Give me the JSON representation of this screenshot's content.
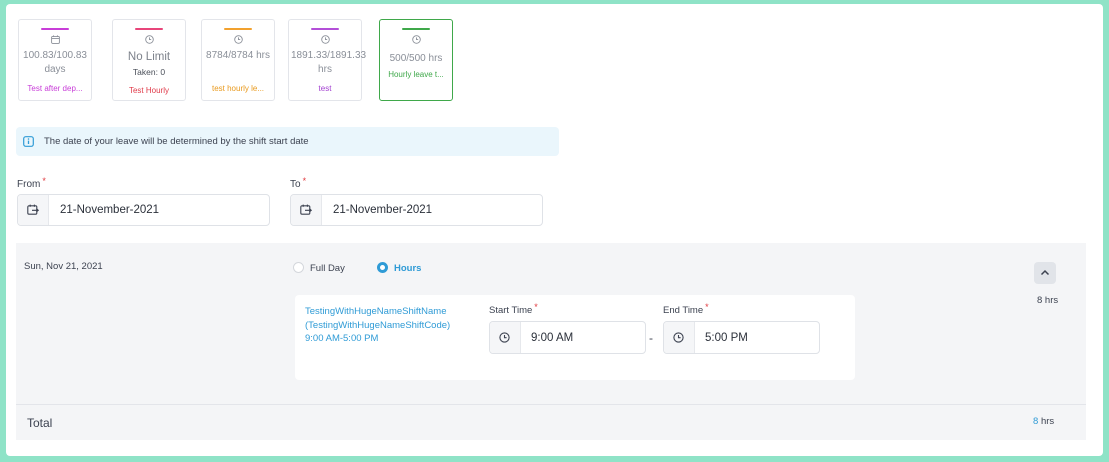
{
  "leave_cards": [
    {
      "value": "100.83/100.83 days",
      "taken": "",
      "name": "Test after dep...",
      "bar_color": "#c83dd8",
      "name_color": "#c83dd8",
      "icon": "calendar-icon",
      "active": false
    },
    {
      "value": "No Limit",
      "taken": "Taken: 0",
      "name": "Test Hourly",
      "bar_color": "#e8457a",
      "name_color": "#e03b4a",
      "icon": "clock-icon",
      "active": false
    },
    {
      "value": "8784/8784 hrs",
      "taken": "",
      "name": "test hourly le...",
      "bar_color": "#f2a12e",
      "name_color": "#e99a1e",
      "icon": "clock-icon",
      "active": false
    },
    {
      "value": "1891.33/1891.33 hrs",
      "taken": "",
      "name": "test",
      "bar_color": "#b34fd8",
      "name_color": "#a23fd0",
      "icon": "clock-icon",
      "active": false
    },
    {
      "value": "500/500 hrs",
      "taken": "",
      "name": "Hourly leave t...",
      "bar_color": "#3fa84a",
      "name_color": "#3fa84a",
      "icon": "clock-icon",
      "active": true
    }
  ],
  "info": {
    "text": "The date of your leave will be determined by the shift start date",
    "icon": "info-icon"
  },
  "from": {
    "label": "From",
    "required": "*",
    "value": "21-November-2021",
    "icon": "calendar-swap-icon"
  },
  "to": {
    "label": "To",
    "required": "*",
    "value": "21-November-2021",
    "icon": "calendar-swap-icon"
  },
  "day": {
    "date": "Sun, Nov 21, 2021",
    "full_day_label": "Full Day",
    "hours_label": "Hours",
    "selected": "hours",
    "hours_total": "8 hrs",
    "shift": {
      "name": "TestingWithHugeNameShiftName",
      "code": "(TestingWithHugeNameShiftCode)",
      "time": "9:00 AM-5:00 PM"
    },
    "start_time": {
      "label": "Start Time",
      "required": "*",
      "value": "9:00 AM"
    },
    "end_time": {
      "label": "End Time",
      "required": "*",
      "value": "5:00 PM"
    },
    "separator": "-"
  },
  "total": {
    "label": "Total",
    "value": "8",
    "unit": "hrs"
  }
}
